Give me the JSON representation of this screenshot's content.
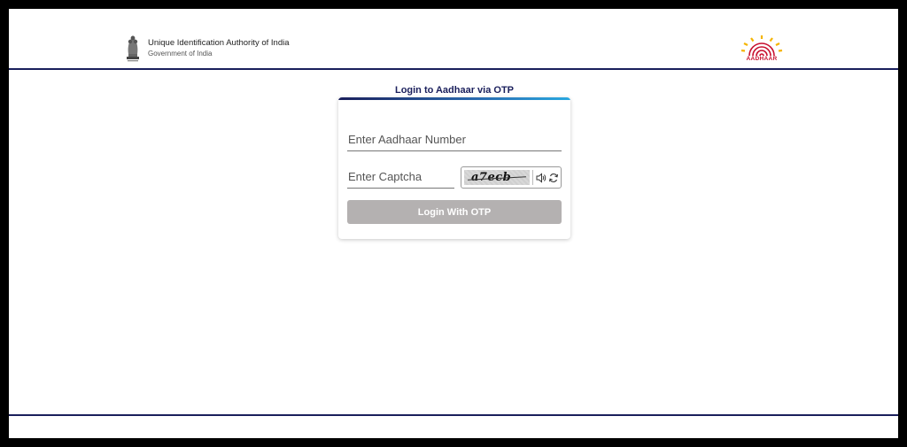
{
  "header": {
    "org_name": "Unique Identification Authority of India",
    "org_sub": "Government of India",
    "aadhaar_logo_text": "AADHAAR",
    "emblem_icon": "national-emblem-icon"
  },
  "login": {
    "title": "Login to Aadhaar via OTP",
    "aadhaar_placeholder": "Enter Aadhaar Number",
    "aadhaar_value": "",
    "captcha_placeholder": "Enter Captcha",
    "captcha_value": "",
    "captcha_image_text": "a7ecb",
    "button_label": "Login With OTP"
  },
  "colors": {
    "primary_navy": "#1a1f5c",
    "button_disabled": "#b4b1b1",
    "aadhaar_red": "#c8102e",
    "aadhaar_yellow": "#f5b400"
  }
}
